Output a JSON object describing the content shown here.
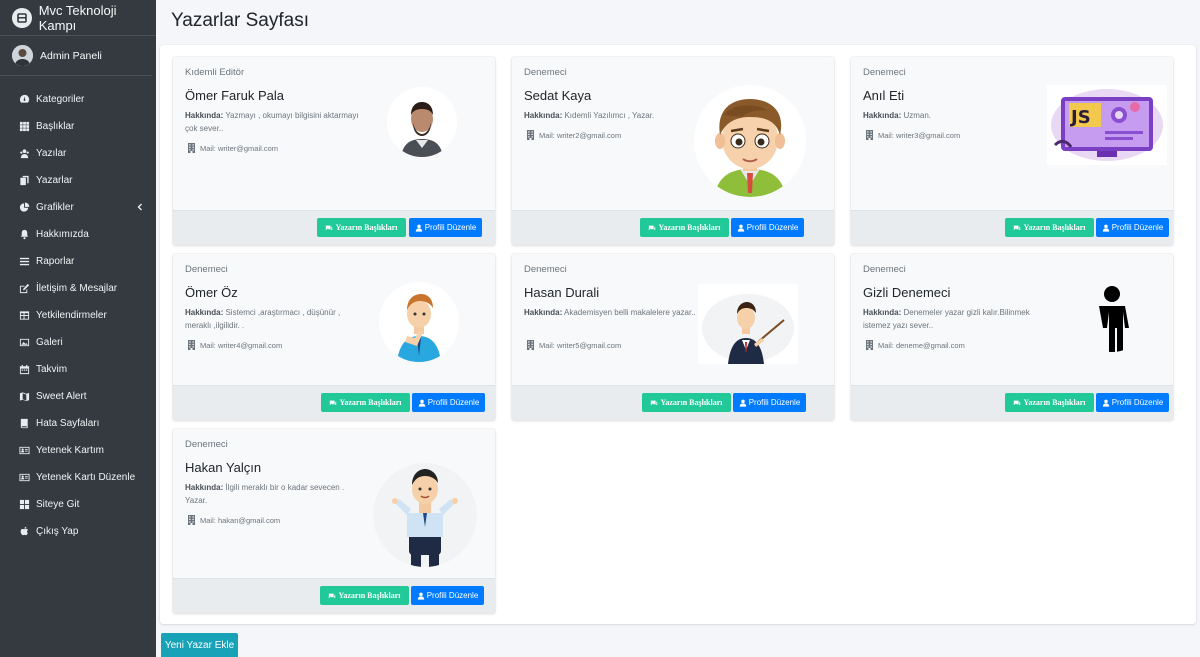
{
  "brand": {
    "title": "Mvc Teknoloji Kampı"
  },
  "user": {
    "name": "Admin Paneli"
  },
  "nav": [
    {
      "label": "Kategoriler",
      "icon": "dashboard-icon"
    },
    {
      "label": "Başlıklar",
      "icon": "grid-icon"
    },
    {
      "label": "Yazılar",
      "icon": "people-icon"
    },
    {
      "label": "Yazarlar",
      "icon": "copy-icon"
    },
    {
      "label": "Grafikler",
      "icon": "pie-chart-icon"
    },
    {
      "label": "Hakkımızda",
      "icon": "bell-icon"
    },
    {
      "label": "Raporlar",
      "icon": "list-icon"
    },
    {
      "label": "İletişim & Mesajlar",
      "icon": "edit-icon"
    },
    {
      "label": "Yetkilendirmeler",
      "icon": "table-icon"
    },
    {
      "label": "Galeri",
      "icon": "image-icon"
    },
    {
      "label": "Takvim",
      "icon": "calendar-icon"
    },
    {
      "label": "Sweet Alert",
      "icon": "map-icon"
    },
    {
      "label": "Hata Sayfaları",
      "icon": "book-icon"
    },
    {
      "label": "Yetenek Kartım",
      "icon": "id-card-icon"
    },
    {
      "label": "Yetenek Kartı Düzenle",
      "icon": "id-card-icon"
    },
    {
      "label": "Siteye Git",
      "icon": "sitemap-icon"
    },
    {
      "label": "Çıkış Yap",
      "icon": "apple-icon"
    }
  ],
  "page": {
    "title": "Yazarlar Sayfası",
    "add_button": "Yeni Yazar Ekle"
  },
  "labels": {
    "about": "Hakkında:",
    "mail": "Mail:",
    "titles_button": "Yazarın Başlıkları",
    "edit_button": "Profili Düzenle"
  },
  "writers": [
    {
      "role": "Kıdemli Editör",
      "name": "Ömer Faruk Pala",
      "about": "Yazmayı , okumayı bilgisini aktarmayı çok sever..",
      "mail": "writer@gmail.com",
      "avatar": "man-photo"
    },
    {
      "role": "Denemeci",
      "name": "Sedat Kaya",
      "about": "Kıdemli Yazılımcı , Yazar.",
      "mail": "writer2@gmail.com",
      "avatar": "cartoon-boy"
    },
    {
      "role": "Denemeci",
      "name": "Anıl Eti",
      "about": "Uzman.",
      "mail": "writer3@gmail.com",
      "avatar": "js-illustration"
    },
    {
      "role": "Denemeci",
      "name": "Ömer Öz",
      "about": "Sistemci ,araştırmacı , düşünür , meraklı ,ilgilidir. .",
      "mail": "writer4@gmail.com",
      "avatar": "thinking-man"
    },
    {
      "role": "Denemeci",
      "name": "Hasan Durali",
      "about": "Akademisyen belli makalelere yazar..",
      "mail": "writer5@gmail.com",
      "avatar": "teacher"
    },
    {
      "role": "Denemeci",
      "name": "Gizli Denemeci",
      "about": "Denemeler yazar gizli kalır.Bilinmek istemez yazı sever..",
      "mail": "deneme@gmail.com",
      "avatar": "silhouette"
    },
    {
      "role": "Denemeci",
      "name": "Hakan Yalçın",
      "about": "İlgili meraklı bir o kadar sevecen . Yazar.",
      "mail": "hakan@gmail.com",
      "avatar": "shrug-man"
    }
  ]
}
